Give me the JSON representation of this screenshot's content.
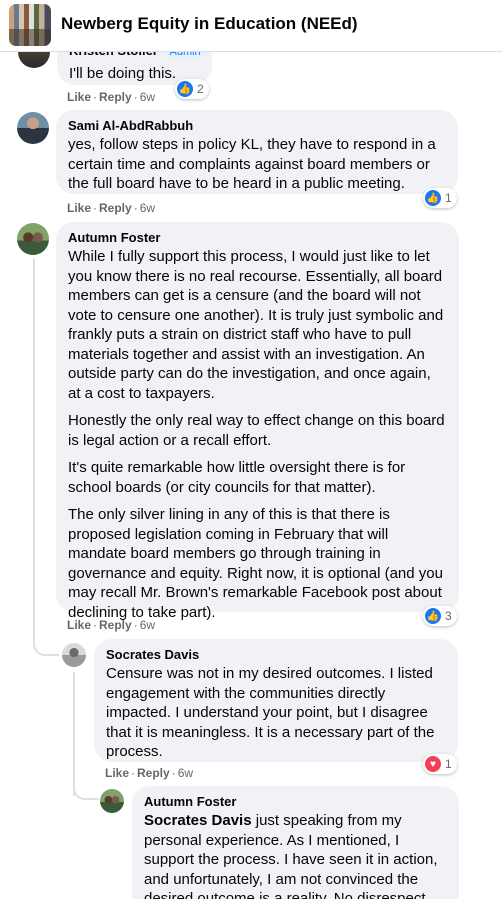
{
  "header": {
    "title": "Newberg Equity in Education (NEEd)"
  },
  "comments": [
    {
      "author": "Kristen Stoller",
      "badge": "Admin",
      "text": "I'll be doing this.",
      "like": "Like",
      "reply": "Reply",
      "time": "6w",
      "reactions": "2",
      "reaction_type": "like"
    },
    {
      "author": "Sami Al-AbdRabbuh",
      "text": "yes, follow steps in policy KL, they have to respond in a certain time and complaints against board members or the full board have to be heard in a public meeting.",
      "like": "Like",
      "reply": "Reply",
      "time": "6w",
      "reactions": "1",
      "reaction_type": "like"
    },
    {
      "author": "Autumn Foster",
      "paragraphs": [
        "While I fully support this process, I would just like to let you know there is no real recourse. Essentially, all board members can get is a censure (and the board will not vote to censure one another). It is truly just symbolic and frankly puts a strain on district staff who have to pull materials together and assist with an investigation. An outside party can do the investigation, and once again, at a cost to taxpayers.",
        "Honestly the only real way to effect change on this board is legal action or a recall effort.",
        "It's quite remarkable how little oversight there is for school boards (or city councils for that matter).",
        "The only silver lining in any of this is that there is proposed legislation coming in February that will mandate board members go through training in governance and equity. Right now, it is optional (and you may recall Mr. Brown's remarkable Facebook post about declining to take part)."
      ],
      "like": "Like",
      "reply": "Reply",
      "time": "6w",
      "reactions": "3",
      "reaction_type": "like"
    },
    {
      "author": "Socrates Davis",
      "text": "Censure was not in my desired outcomes. I listed engagement with the communities directly impacted. I understand your point, but I disagree that it is meaningless. It is a necessary part of the process.",
      "like": "Like",
      "reply": "Reply",
      "time": "6w",
      "reactions": "1",
      "reaction_type": "love"
    },
    {
      "author": "Autumn Foster",
      "mention": "Socrates Davis",
      "text": " just speaking from my personal experience. As I mentioned, I support the process. I have seen it in action, and unfortunately, I am not convinced the desired outcome is a reality. No disrespect"
    }
  ]
}
